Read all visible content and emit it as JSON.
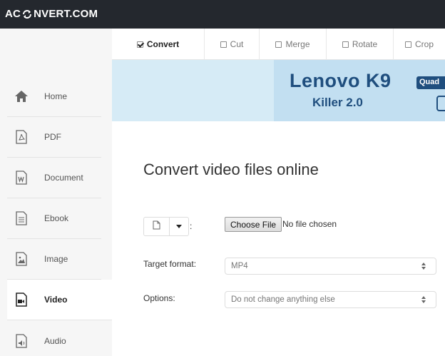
{
  "brand": {
    "logo_left": "AC",
    "logo_right": "NVERT.COM"
  },
  "sidebar": {
    "items": [
      {
        "label": "Home",
        "icon": "home-icon"
      },
      {
        "label": "PDF",
        "icon": "pdf-file-icon"
      },
      {
        "label": "Document",
        "icon": "word-file-icon"
      },
      {
        "label": "Ebook",
        "icon": "ebook-file-icon"
      },
      {
        "label": "Image",
        "icon": "image-file-icon"
      },
      {
        "label": "Video",
        "icon": "video-file-icon",
        "active": true
      },
      {
        "label": "Audio",
        "icon": "audio-file-icon"
      }
    ]
  },
  "tabs": [
    {
      "label": "Convert",
      "checked": true
    },
    {
      "label": "Cut",
      "checked": false
    },
    {
      "label": "Merge",
      "checked": false
    },
    {
      "label": "Rotate",
      "checked": false
    },
    {
      "label": "Crop",
      "checked": false
    }
  ],
  "ad": {
    "title": "Lenovo K9",
    "subtitle": "Killer 2.0",
    "badge": "Quad"
  },
  "main": {
    "title": "Convert video files online",
    "source_colon": ":",
    "choose_file_label": "Choose File",
    "no_file_text": "No file chosen",
    "target_format_label": "Target format:",
    "target_format_value": "MP4",
    "options_label": "Options:",
    "options_value": "Do not change anything else"
  },
  "colors": {
    "topbar": "#24282e",
    "ad_text": "#1f4e7e",
    "ad_bg": "#c2dff1"
  }
}
